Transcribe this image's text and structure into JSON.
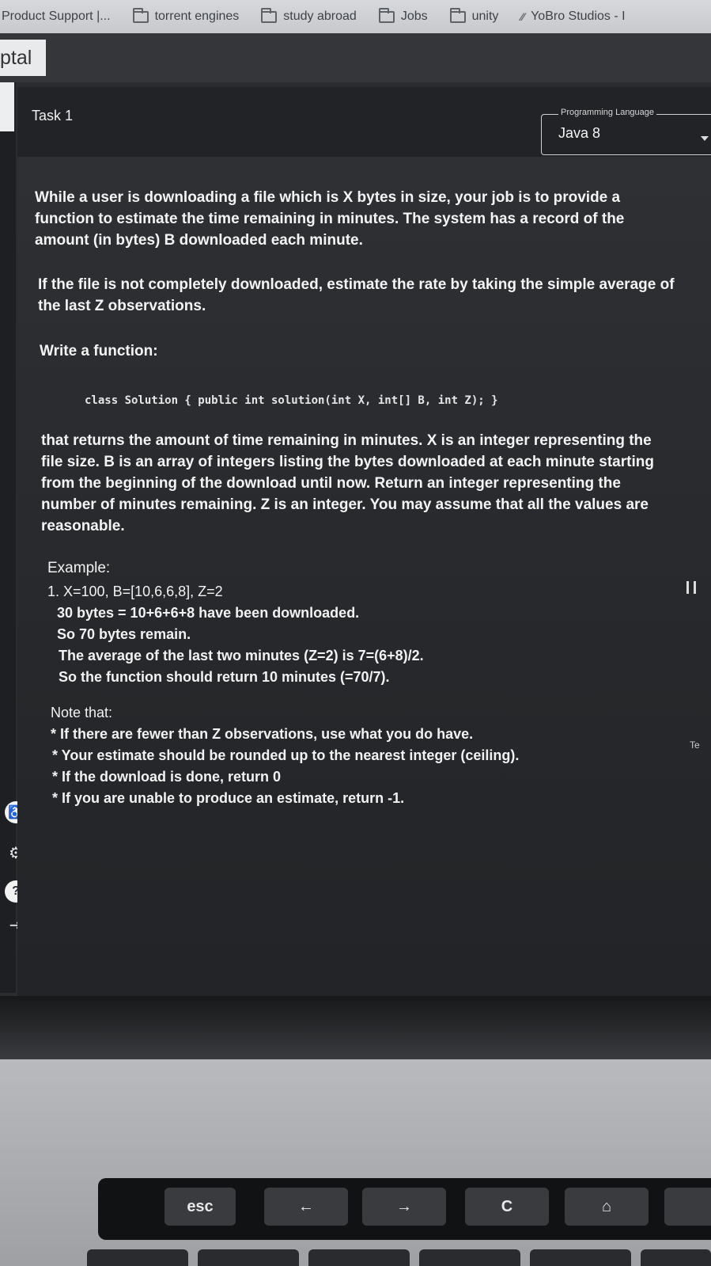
{
  "bookmarks": [
    {
      "label": "Product Support |...",
      "icon": "page-icon"
    },
    {
      "label": "torrent engines",
      "icon": "folder-icon"
    },
    {
      "label": "study abroad",
      "icon": "folder-icon"
    },
    {
      "label": "Jobs",
      "icon": "folder-icon"
    },
    {
      "label": "unity",
      "icon": "folder-icon"
    },
    {
      "label": "YoBro Studios - I",
      "icon": "toptal-icon"
    }
  ],
  "brand": "ptal",
  "task": {
    "title": "Task 1",
    "language_label": "Programming Language",
    "language_value": "Java 8"
  },
  "problem": {
    "p1": "While a user is downloading a file which is X bytes in size, your job is to provide a function to estimate the time remaining in minutes. The system has a record of the amount (in bytes) B downloaded each minute.",
    "p2": "If the file is not completely downloaded, estimate the rate by taking the simple average of the last Z observations.",
    "p3": "Write a function:",
    "code": "class Solution { public int solution(int X, int[] B, int Z); }",
    "p4": "that returns the amount of time remaining in minutes. X is an integer representing the file size. B is an array of integers listing the bytes downloaded at each minute starting from the beginning of the download until now. Return an integer representing the number of minutes remaining. Z is an integer. You may assume that all the values are reasonable.",
    "example_heading": "Example:",
    "example_lines": [
      "1. X=100, B=[10,6,6,8], Z=2",
      "30 bytes = 10+6+6+8 have been downloaded.",
      "So 70 bytes remain.",
      "The average of the last two minutes (Z=2) is 7=(6+8)/2.",
      "So the function should return 10 minutes (=70/7)."
    ],
    "note_heading": "Note that:",
    "notes": [
      "* If there are fewer than Z observations, use what you do have.",
      "* Your estimate should be rounded up to the nearest integer (ceiling).",
      "* If the download is done, return 0",
      "* If you are unable to produce an estimate, return -1."
    ]
  },
  "side": {
    "te": "Te"
  },
  "rail_icons": [
    "accessibility-icon",
    "gear-icon",
    "help-icon",
    "logout-icon"
  ],
  "touchbar": {
    "esc": "esc",
    "back": "←",
    "forward": "→",
    "reload": "C",
    "home": "⌂"
  },
  "colors": {
    "background": "#2a2c30",
    "bookmarks_bar": "#d0d2d6",
    "text": "#f2f2f2"
  }
}
